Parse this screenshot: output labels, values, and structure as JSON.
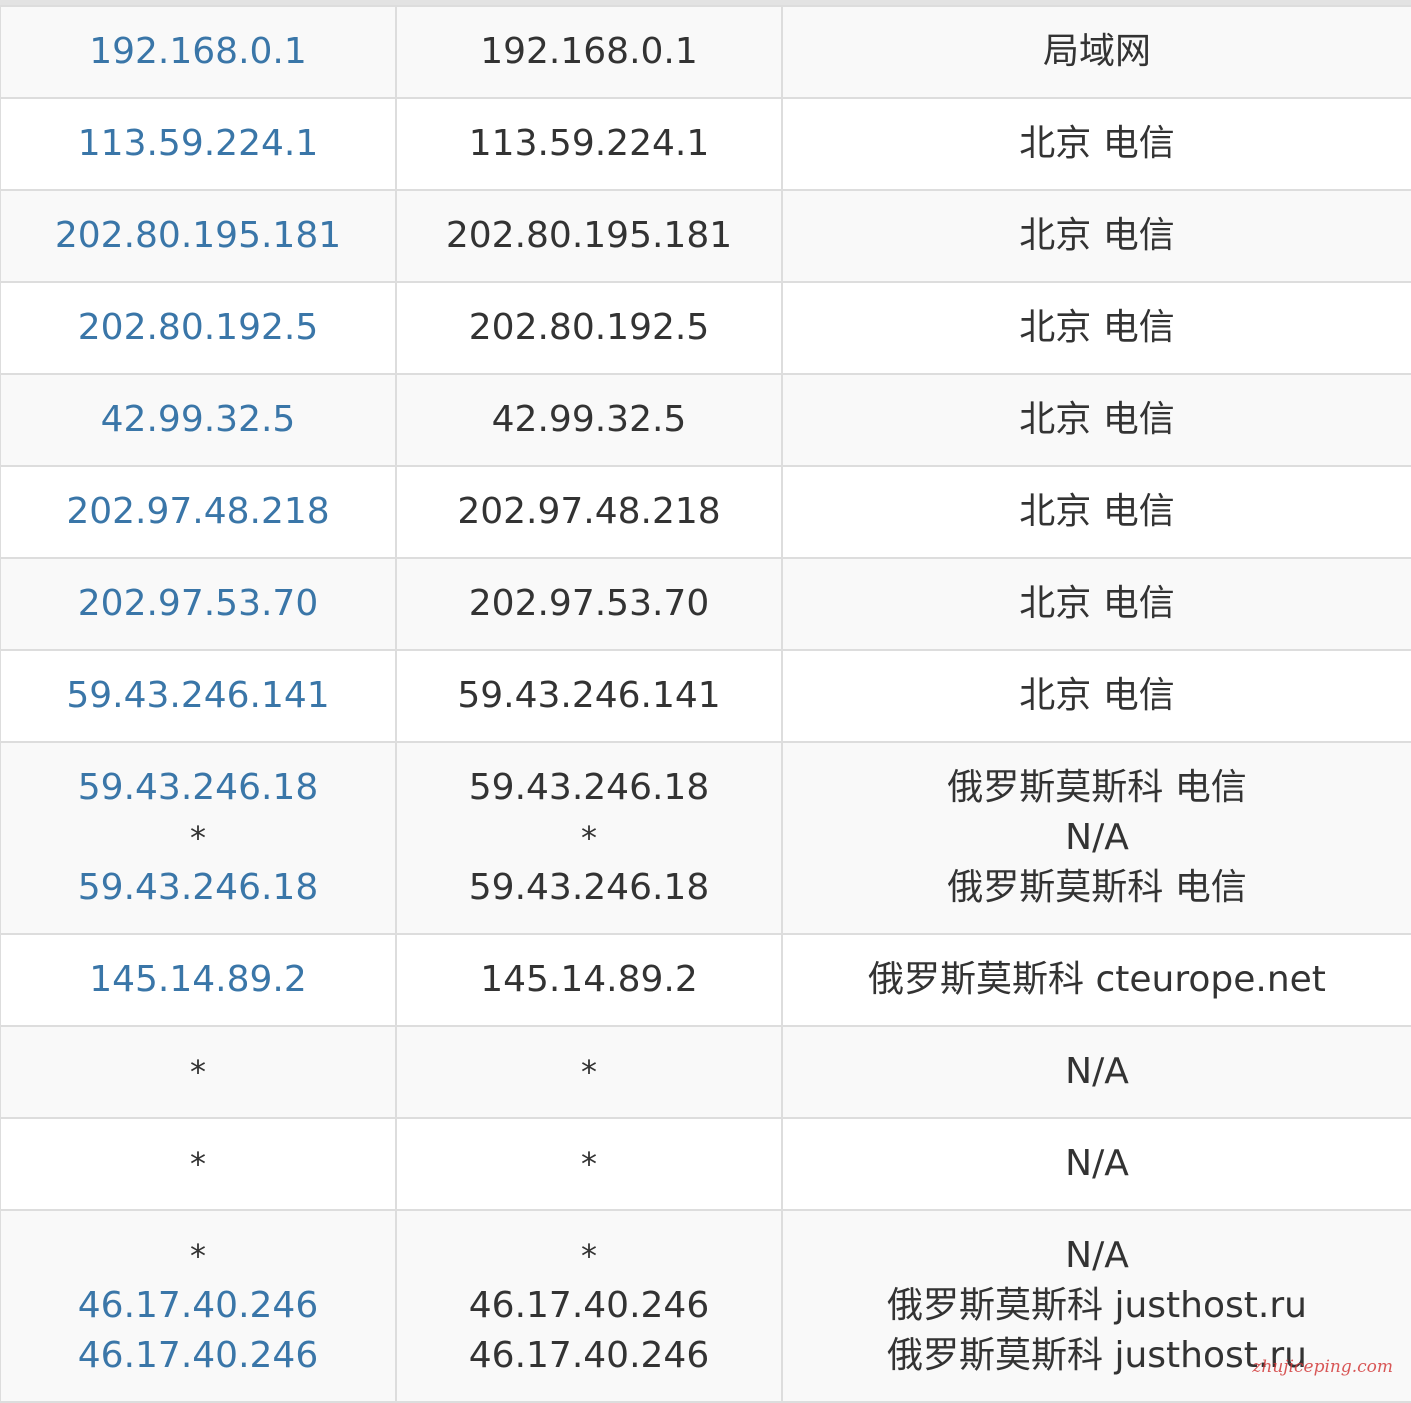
{
  "rows": [
    {
      "ip": [
        "192.168.0.1"
      ],
      "host": [
        "192.168.0.1"
      ],
      "location": [
        "局域网"
      ]
    },
    {
      "ip": [
        "113.59.224.1"
      ],
      "host": [
        "113.59.224.1"
      ],
      "location": [
        "北京 电信"
      ]
    },
    {
      "ip": [
        "202.80.195.181"
      ],
      "host": [
        "202.80.195.181"
      ],
      "location": [
        "北京 电信"
      ]
    },
    {
      "ip": [
        "202.80.192.5"
      ],
      "host": [
        "202.80.192.5"
      ],
      "location": [
        "北京 电信"
      ]
    },
    {
      "ip": [
        "42.99.32.5"
      ],
      "host": [
        "42.99.32.5"
      ],
      "location": [
        "北京 电信"
      ]
    },
    {
      "ip": [
        "202.97.48.218"
      ],
      "host": [
        "202.97.48.218"
      ],
      "location": [
        "北京 电信"
      ]
    },
    {
      "ip": [
        "202.97.53.70"
      ],
      "host": [
        "202.97.53.70"
      ],
      "location": [
        "北京 电信"
      ]
    },
    {
      "ip": [
        "59.43.246.141"
      ],
      "host": [
        "59.43.246.141"
      ],
      "location": [
        "北京 电信"
      ]
    },
    {
      "ip": [
        "59.43.246.18",
        "*",
        "59.43.246.18"
      ],
      "host": [
        "59.43.246.18",
        "*",
        "59.43.246.18"
      ],
      "location": [
        "俄罗斯莫斯科 电信",
        "N/A",
        "俄罗斯莫斯科 电信"
      ]
    },
    {
      "ip": [
        "145.14.89.2"
      ],
      "host": [
        "145.14.89.2"
      ],
      "location": [
        "俄罗斯莫斯科 cteurope.net"
      ]
    },
    {
      "ip": [
        "*"
      ],
      "host": [
        "*"
      ],
      "location": [
        "N/A"
      ]
    },
    {
      "ip": [
        "*"
      ],
      "host": [
        "*"
      ],
      "location": [
        "N/A"
      ]
    },
    {
      "ip": [
        "*",
        "46.17.40.246",
        "46.17.40.246"
      ],
      "host": [
        "*",
        "46.17.40.246",
        "46.17.40.246"
      ],
      "location": [
        "N/A",
        "俄罗斯莫斯科 justhost.ru",
        "俄罗斯莫斯科 justhost.ru"
      ]
    }
  ],
  "watermark": "zhujiceping.com",
  "colors": {
    "link": "#3a76a8",
    "text": "#333333",
    "stripe": "#f9f9f9",
    "border": "#dddddd",
    "watermark": "#d33a3a"
  }
}
